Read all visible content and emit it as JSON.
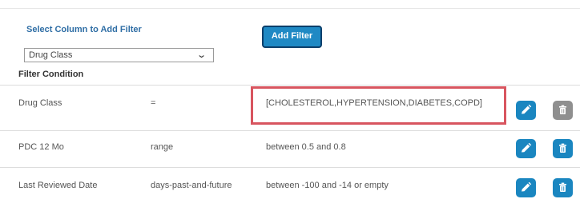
{
  "filter_panel": {
    "select_column_label": "Select Column to Add Filter",
    "column_select": {
      "value": "Drug Class"
    },
    "add_filter_label": "Add Filter",
    "filter_condition_label": "Filter Condition"
  },
  "filters": [
    {
      "column": "Drug Class",
      "operator": "=",
      "value": "[CHOLESTEROL,HYPERTENSION,DIABETES,COPD]",
      "delete_enabled": false
    },
    {
      "column": "PDC 12 Mo",
      "operator": "range",
      "value": "between 0.5 and 0.8",
      "delete_enabled": true
    },
    {
      "column": "Last Reviewed Date",
      "operator": "days-past-and-future",
      "value": "between -100 and -14 or empty",
      "delete_enabled": true
    }
  ],
  "icons": {
    "edit": "pencil-icon",
    "delete": "trash-icon",
    "dropdown": "chevron-down-icon"
  },
  "colors": {
    "accent": "#1a86c0",
    "highlight": "#d8555f",
    "label_blue": "#2f6ea5",
    "disabled": "#8f8f8f"
  }
}
